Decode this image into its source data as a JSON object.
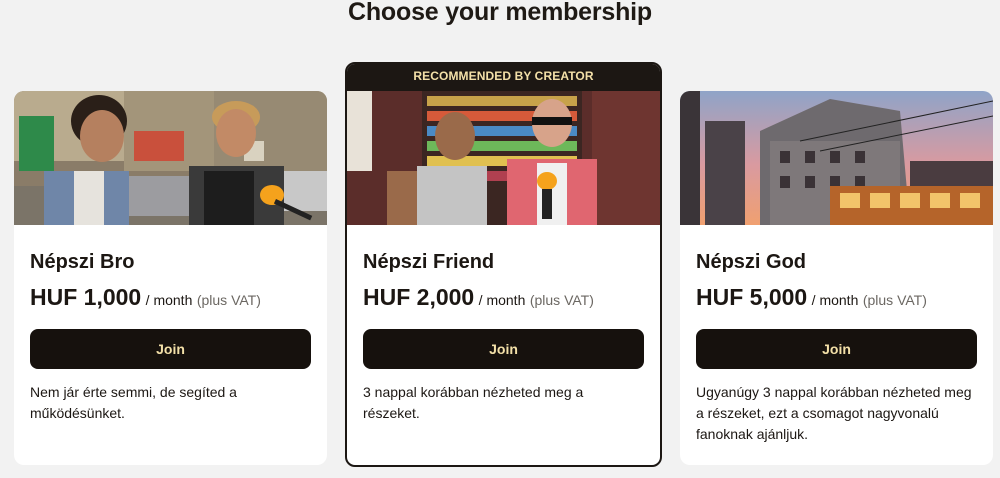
{
  "page": {
    "title": "Choose your membership"
  },
  "tiers": [
    {
      "name": "Népszi Bro",
      "price": "HUF 1,000",
      "period": "/ month",
      "vat": "(plus VAT)",
      "button": "Join",
      "description": "Nem jár érte semmi, de segíted a működésünket."
    },
    {
      "badge": "RECOMMENDED BY CREATOR",
      "name": "Népszi Friend",
      "price": "HUF 2,000",
      "period": "/ month",
      "vat": "(plus VAT)",
      "button": "Join",
      "description": "3 nappal korábban nézheted meg a részeket."
    },
    {
      "name": "Népszi God",
      "price": "HUF 5,000",
      "period": "/ month",
      "vat": "(plus VAT)",
      "button": "Join",
      "description": "Ugyanúgy 3 nappal korábban nézheted meg a részeket, ezt a csomagot nagyvonalú fanoknak ajánljuk."
    }
  ],
  "colors": {
    "background": "#f2f2f2",
    "card": "#ffffff",
    "button": "#16110d",
    "button_text": "#f3e0a8"
  }
}
